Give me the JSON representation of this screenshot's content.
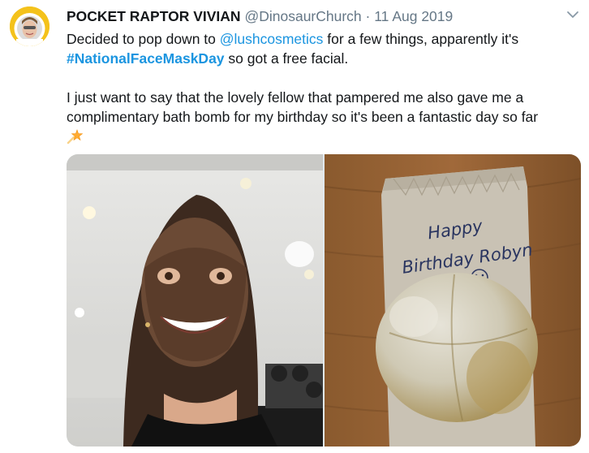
{
  "author": {
    "display_name": "POCKET RAPTOR VIVIAN",
    "handle": "@DinosaurChurch",
    "separator": "·",
    "date": "11 Aug 2019"
  },
  "tweet": {
    "line1_start": "Decided to pop down to ",
    "mention": "@lushcosmetics",
    "line1_end": " for a few things, apparently it's ",
    "hashtag": "#NationalFaceMaskDay",
    "line1_tail": " so got a free facial.",
    "paragraph2": "I just want to say that the lovely fellow that pampered me also gave me a complimentary bath bomb for my birthday so it's been a fantastic day so far"
  },
  "media": {
    "photo_left_icon": "selfie-face-mask-photo",
    "photo_right_icon": "bath-bomb-on-bag-photo",
    "bag_text_line1": "Happy",
    "bag_text_line2": "Birthday Robyn"
  },
  "icons": {
    "avatar": "astronaut-avatar-icon",
    "menu": "chevron-down-icon",
    "emoji": "shooting-star-icon"
  },
  "colors": {
    "link": "#1b95e0",
    "meta": "#657786",
    "text": "#14171a"
  }
}
